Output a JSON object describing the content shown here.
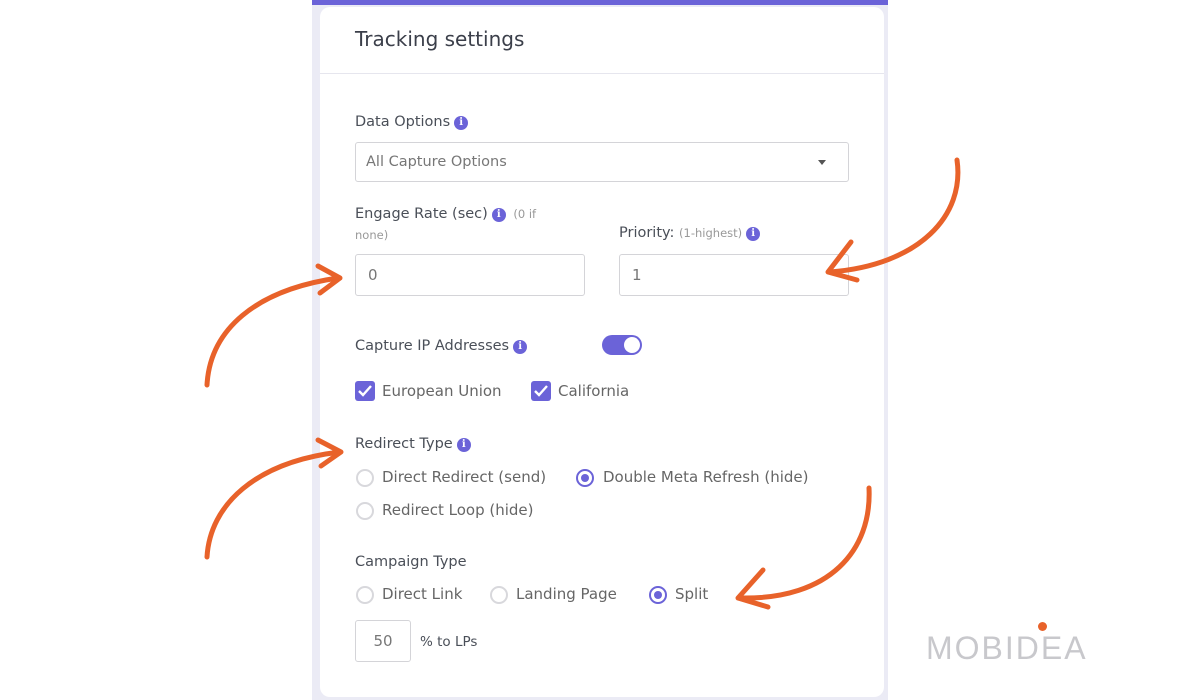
{
  "card": {
    "title": "Tracking settings"
  },
  "data_options": {
    "label": "Data Options",
    "info_icon": "info-icon",
    "select_value": "All Capture Options"
  },
  "engage_rate": {
    "label": "Engage Rate (sec)",
    "hint_line1": "(0 if",
    "hint_line2": "none)",
    "value": "0"
  },
  "priority": {
    "label": "Priority:",
    "hint": "(1-highest)",
    "value": "1"
  },
  "capture_ip": {
    "label": "Capture IP Addresses",
    "toggle_on": true,
    "options": [
      {
        "label": "European Union",
        "checked": true
      },
      {
        "label": "California",
        "checked": true
      }
    ]
  },
  "redirect_type": {
    "label": "Redirect Type",
    "options": [
      {
        "label": "Direct Redirect (send)",
        "selected": false
      },
      {
        "label": "Double Meta Refresh (hide)",
        "selected": true
      },
      {
        "label": "Redirect Loop (hide)",
        "selected": false
      }
    ]
  },
  "campaign_type": {
    "label": "Campaign Type",
    "options": [
      {
        "label": "Direct Link",
        "selected": false
      },
      {
        "label": "Landing Page",
        "selected": false
      },
      {
        "label": "Split",
        "selected": true
      }
    ],
    "split_value": "50",
    "split_suffix": "% to LPs"
  },
  "watermark": {
    "text": "MOBIDEA"
  },
  "colors": {
    "accent": "#6b63d8",
    "annotation_arrow": "#e8622a",
    "panel_bg": "#ebebf5"
  }
}
